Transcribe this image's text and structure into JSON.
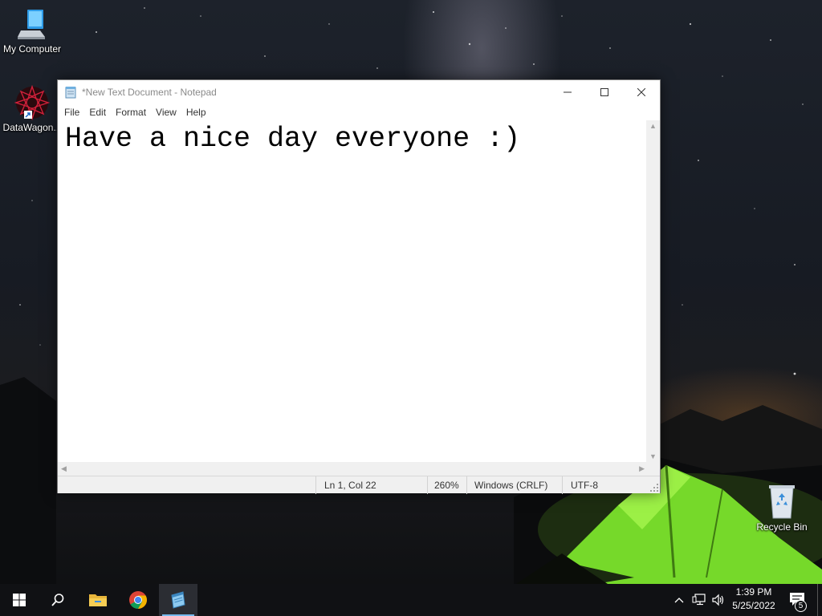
{
  "desktop": {
    "icons": [
      {
        "label": "My Computer"
      },
      {
        "label": "DataWagon..."
      },
      {
        "label": "Recycle Bin"
      }
    ]
  },
  "notepad": {
    "title": "*New Text Document - Notepad",
    "menu": [
      "File",
      "Edit",
      "Format",
      "View",
      "Help"
    ],
    "content": "Have a nice day everyone :)",
    "status": {
      "position": "Ln 1, Col 22",
      "zoom": "260%",
      "line_ending": "Windows (CRLF)",
      "encoding": "UTF-8"
    }
  },
  "taskbar": {
    "items": [
      "start-icon",
      "search-icon",
      "file-explorer-icon",
      "chrome-icon",
      "notepad-icon"
    ],
    "clock": {
      "time": "1:39 PM",
      "date": "5/25/2022"
    },
    "notification_count": "5"
  },
  "colors": {
    "taskbar_bg": "#101114",
    "active_indicator": "#76b9ed",
    "tent_green": "#7fe02a"
  }
}
